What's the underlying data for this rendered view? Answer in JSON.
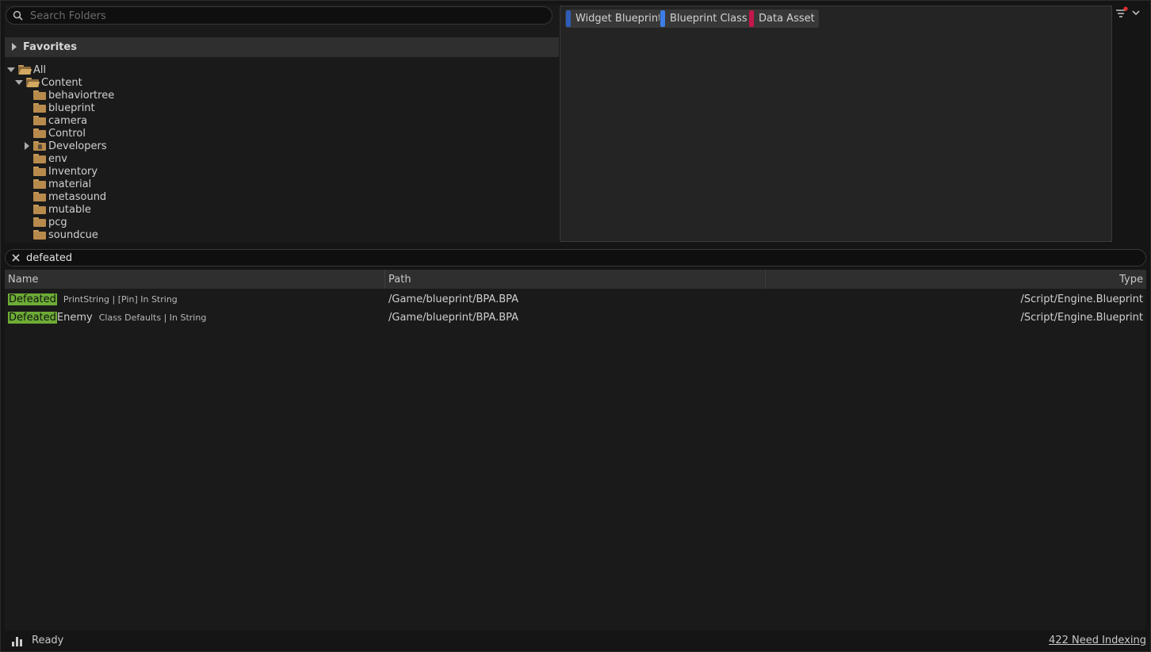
{
  "folder_search": {
    "placeholder": "Search Folders"
  },
  "favorites": {
    "label": "Favorites"
  },
  "tree": {
    "root": "All",
    "content": "Content",
    "children": [
      "behaviortree",
      "blueprint",
      "camera",
      "Control",
      "Developers",
      "env",
      "Inventory",
      "material",
      "metasound",
      "mutable",
      "pcg",
      "soundcue"
    ]
  },
  "filters": {
    "chips": [
      {
        "label": "Widget Blueprint",
        "color": "#2f5cb8"
      },
      {
        "label": "Blueprint Class",
        "color": "#3d7de8"
      },
      {
        "label": "Data Asset",
        "color": "#c4174a"
      }
    ]
  },
  "results_search": {
    "value": "defeated"
  },
  "table": {
    "headers": {
      "name": "Name",
      "path": "Path",
      "type": "Type"
    },
    "rows": [
      {
        "match": "Defeated",
        "rest": "",
        "context": "PrintString | [Pin] In String",
        "path": "/Game/blueprint/BPA.BPA",
        "type": "/Script/Engine.Blueprint"
      },
      {
        "match": "Defeated",
        "rest": "Enemy",
        "context": "Class Defaults | In String",
        "path": "/Game/blueprint/BPA.BPA",
        "type": "/Script/Engine.Blueprint"
      }
    ]
  },
  "status": {
    "text": "Ready",
    "indexing": "422 Need Indexing"
  },
  "colors": {
    "highlight": "#6dad36",
    "folder": "#b88a4c",
    "filter_dot": "#e03030"
  },
  "icons": [
    "search-icon",
    "folder-icon",
    "folder-open-icon",
    "developer-folder-icon",
    "filter-icon",
    "chevron-down-icon",
    "close-icon",
    "status-bars-icon"
  ]
}
